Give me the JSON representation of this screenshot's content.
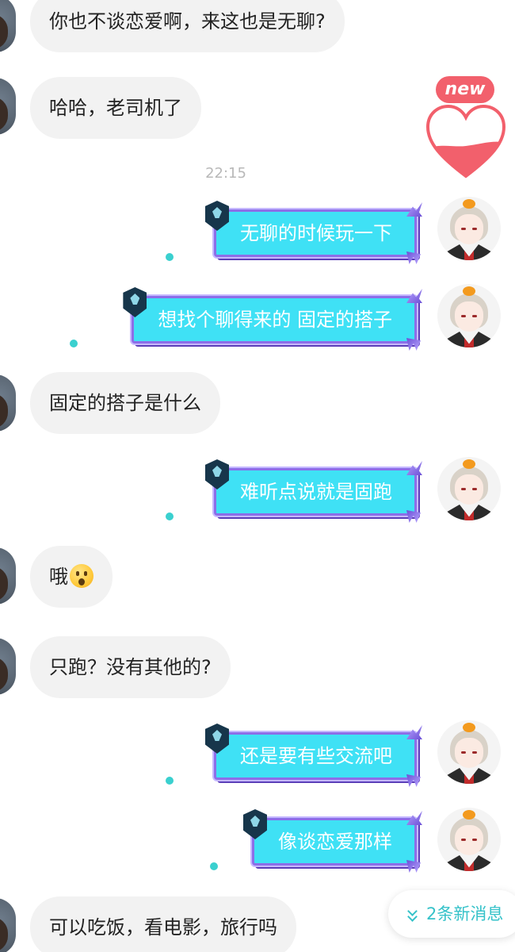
{
  "timestamp": "22:15",
  "new_badge": "new",
  "new_messages_label": "2条新消息",
  "messages": [
    {
      "side": "in",
      "text": "你也不谈恋爱啊，来这也是无聊?"
    },
    {
      "side": "in",
      "text": "哈哈，老司机了"
    },
    {
      "side": "out",
      "text": "无聊的时候玩一下"
    },
    {
      "side": "out",
      "text": "想找个聊得来的 固定的搭子"
    },
    {
      "side": "in",
      "text": "固定的搭子是什么"
    },
    {
      "side": "out",
      "text": "难听点说就是固跑"
    },
    {
      "side": "in",
      "text": "哦"
    },
    {
      "side": "in",
      "text": "只跑？没有其他的?"
    },
    {
      "side": "out",
      "text": "还是要有些交流吧"
    },
    {
      "side": "out",
      "text": "像谈恋爱那样"
    },
    {
      "side": "in",
      "text": "可以吃饭，看电影，旅行吗"
    }
  ],
  "icons": {
    "surprised_emoji": "astonished-face-icon",
    "badge": "worlds-badge-icon",
    "heart": "heart-icon",
    "chevron": "double-chevron-down-icon"
  },
  "colors": {
    "bubble_in": "#f2f2f2",
    "bubble_out": "#3fe1f5",
    "bubble_out_border": "#8c6ee8",
    "accent": "#35c2c9",
    "new_badge": "#f2606c"
  }
}
